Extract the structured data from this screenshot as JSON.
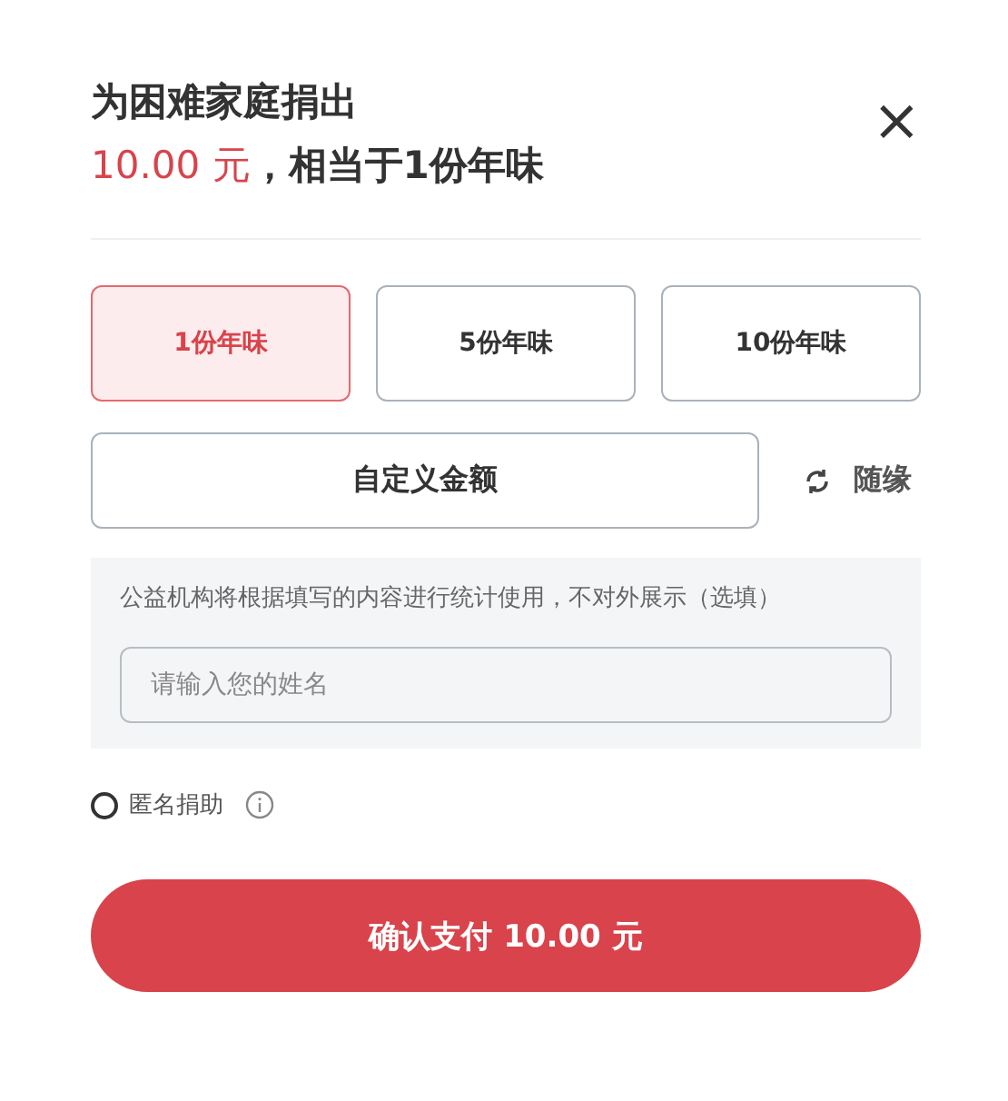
{
  "header": {
    "title": "为困难家庭捐出",
    "amount": "10.00 元",
    "summary": "，相当于1份年味",
    "close": "×"
  },
  "options": [
    {
      "label": "1份年味",
      "selected": true
    },
    {
      "label": "5份年味",
      "selected": false
    },
    {
      "label": "10份年味",
      "selected": false
    }
  ],
  "custom_amount": {
    "label": "自定义金额"
  },
  "random": {
    "label": "随缘"
  },
  "note": {
    "text": "公益机构将根据填写的内容进行统计使用，不对外展示（选填）",
    "name_field": {
      "placeholder": "请输入您的姓名"
    }
  },
  "anonymous": {
    "label": "匿名捐助",
    "checked": false
  },
  "pay_button": {
    "label": "确认支付 10.00 元"
  }
}
